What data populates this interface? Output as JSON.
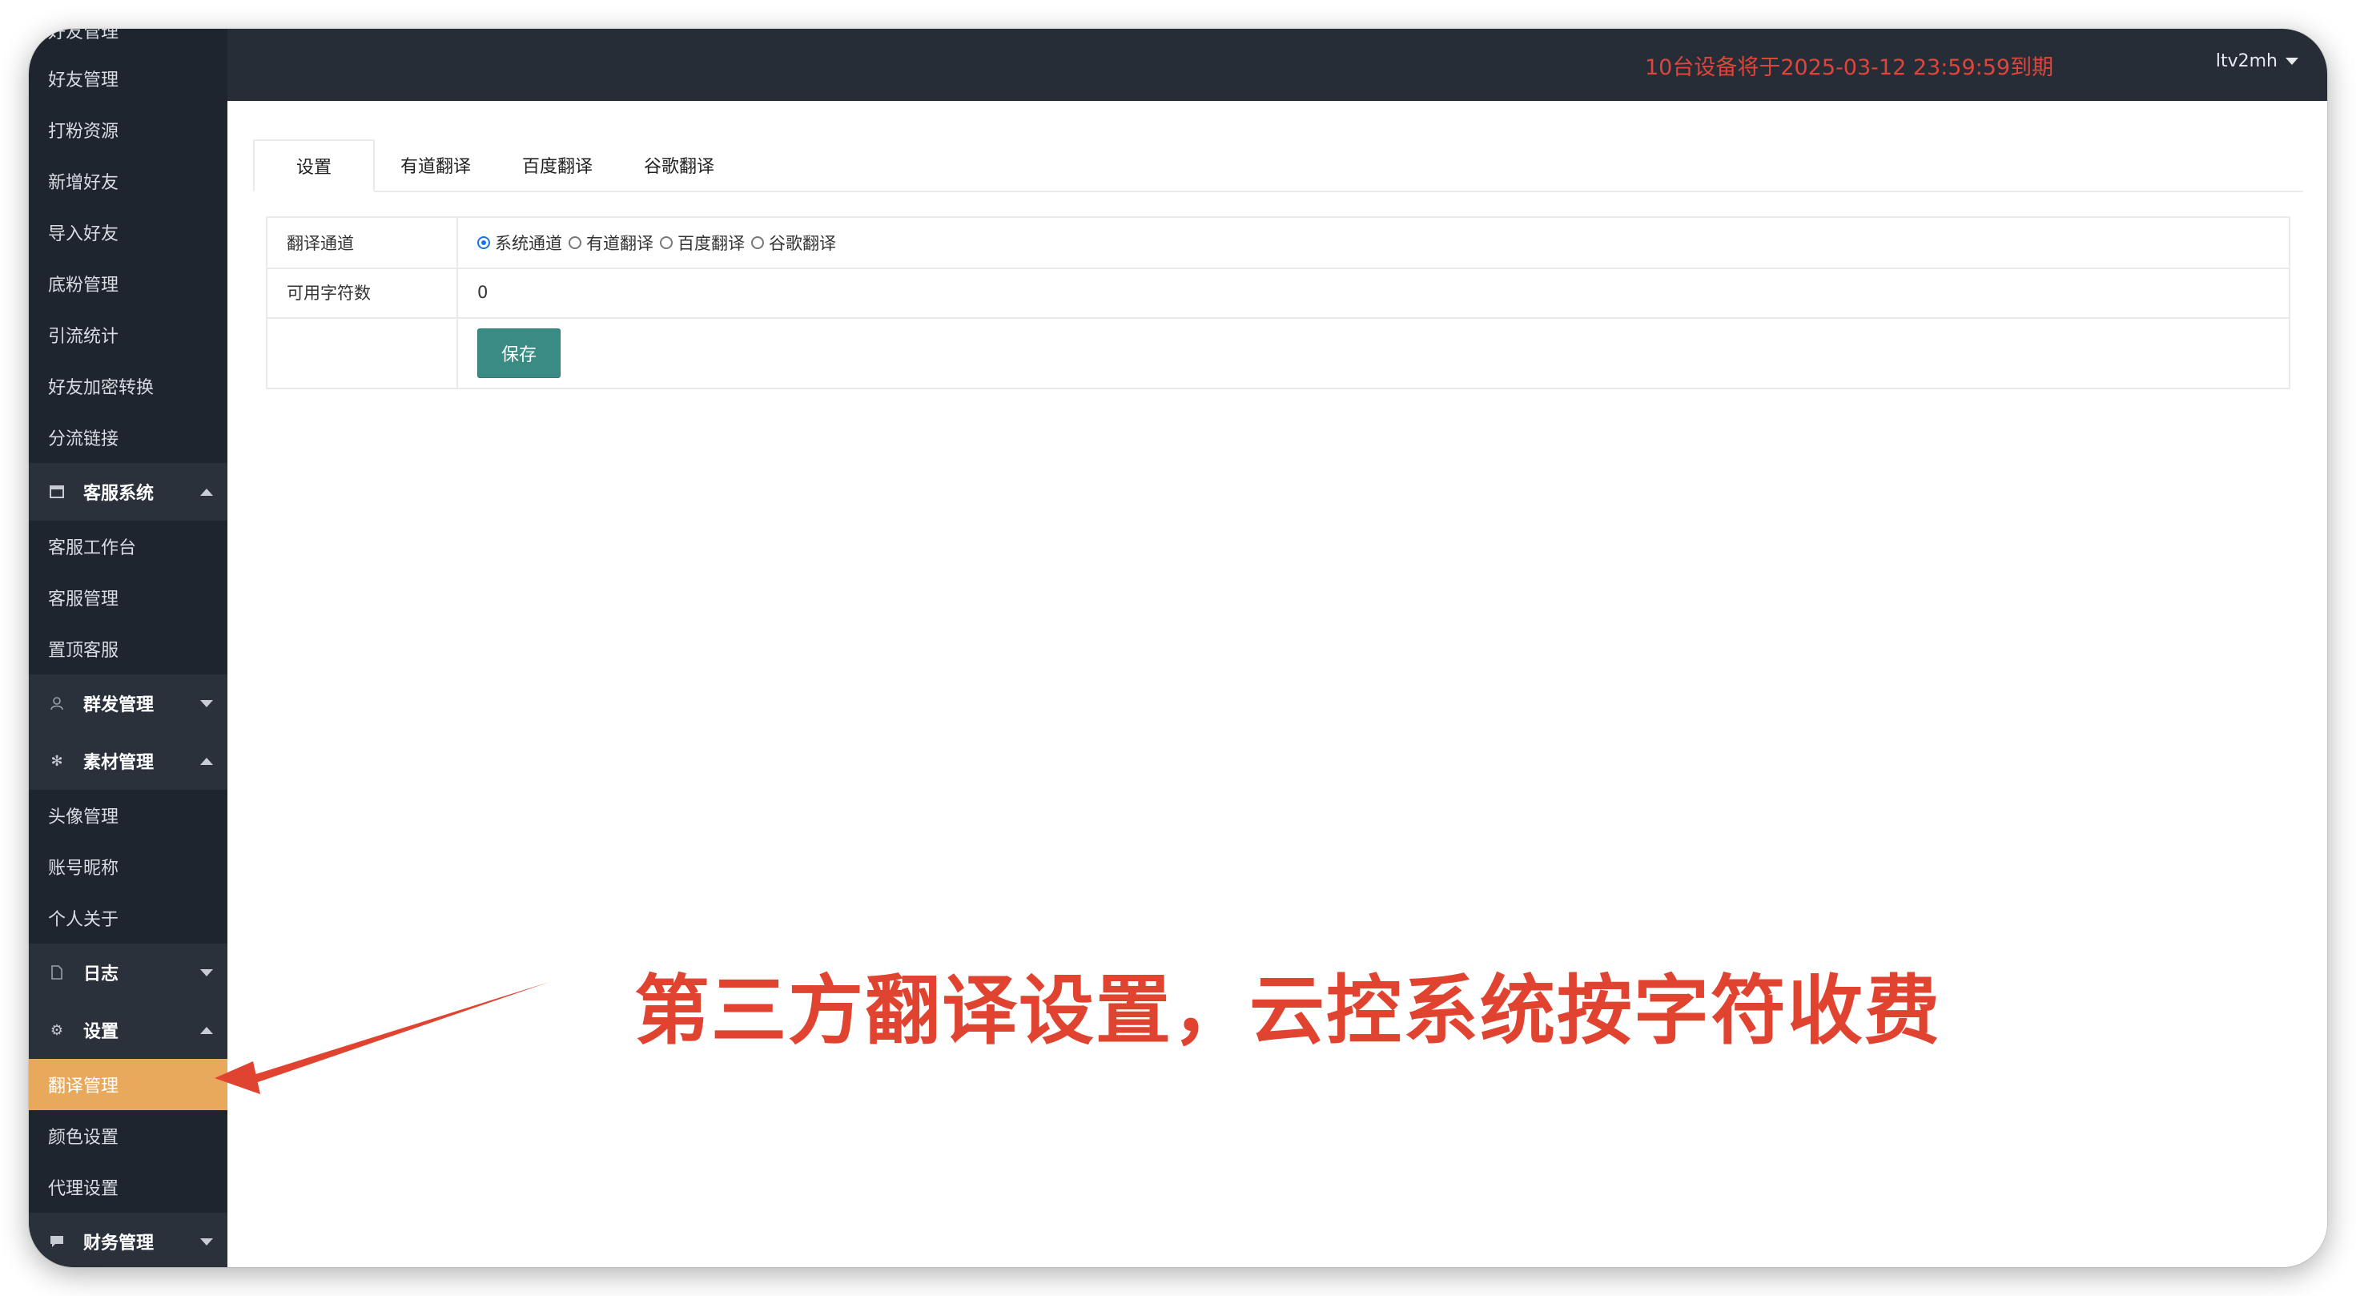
{
  "sidebar": {
    "cut_top_label": "好友管理",
    "items_top": [
      "好友管理",
      "打粉资源",
      "新增好友",
      "导入好友",
      "底粉管理",
      "引流统计",
      "好友加密转换",
      "分流链接"
    ],
    "group_customer": {
      "label": "客服系统",
      "icon": "window-icon"
    },
    "items_customer": [
      "客服工作台",
      "客服管理",
      "置顶客服"
    ],
    "group_broadcast": {
      "label": "群发管理",
      "icon": "user-icon"
    },
    "group_material": {
      "label": "素材管理",
      "icon": "snowflake-icon"
    },
    "items_material": [
      "头像管理",
      "账号昵称",
      "个人关于"
    ],
    "group_log": {
      "label": "日志",
      "icon": "document-icon"
    },
    "group_settings": {
      "label": "设置",
      "icon": "gear-icon"
    },
    "items_settings": [
      "翻译管理",
      "颜色设置",
      "代理设置"
    ],
    "group_finance": {
      "label": "财务管理",
      "icon": "chat-icon"
    }
  },
  "header": {
    "notice": "10台设备将于2025-03-12 23:59:59到期",
    "username": "ltv2mh"
  },
  "tabs": [
    "设置",
    "有道翻译",
    "百度翻译",
    "谷歌翻译"
  ],
  "form": {
    "channel_label": "翻译通道",
    "channel_options": [
      "系统通道",
      "有道翻译",
      "百度翻译",
      "谷歌翻译"
    ],
    "channel_selected": "系统通道",
    "chars_label": "可用字符数",
    "chars_value": "0",
    "save_label": "保存"
  },
  "annotation": "第三方翻译设置，云控系统按字符收费",
  "colors": {
    "sidebar_bg": "#1f252e",
    "active_item": "#e9a95c",
    "save_button": "#3a8b83",
    "notice_red": "#e0443a",
    "annotation_red": "#e0432f"
  }
}
